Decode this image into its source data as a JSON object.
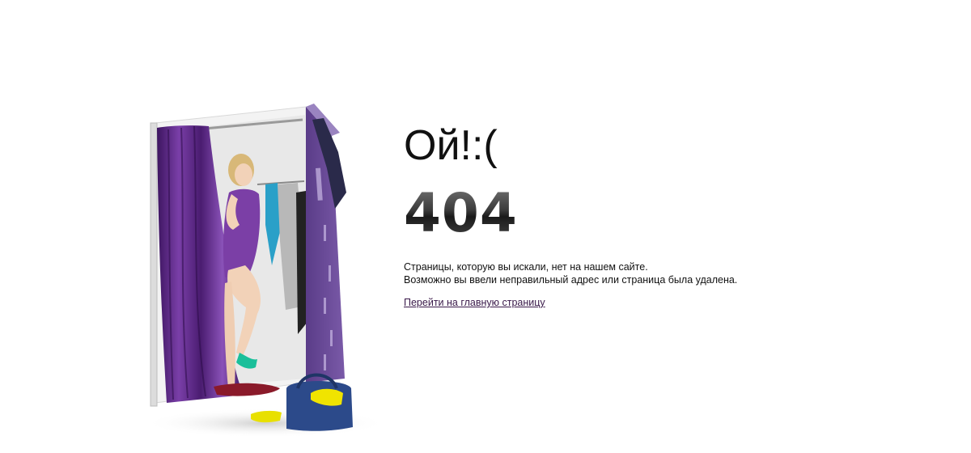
{
  "error_page": {
    "title": "Ой!:(",
    "code": "404",
    "message_line1": "Страницы, которую вы искали, нет на нашем сайте.",
    "message_line2": "Возможно вы ввели неправильный адрес или страница была удалена.",
    "home_link": "Перейти на главную страницу"
  },
  "colors": {
    "curtain": "#5a2a82",
    "booth_panel": "#6b4a96",
    "link": "#3a1a4a"
  }
}
